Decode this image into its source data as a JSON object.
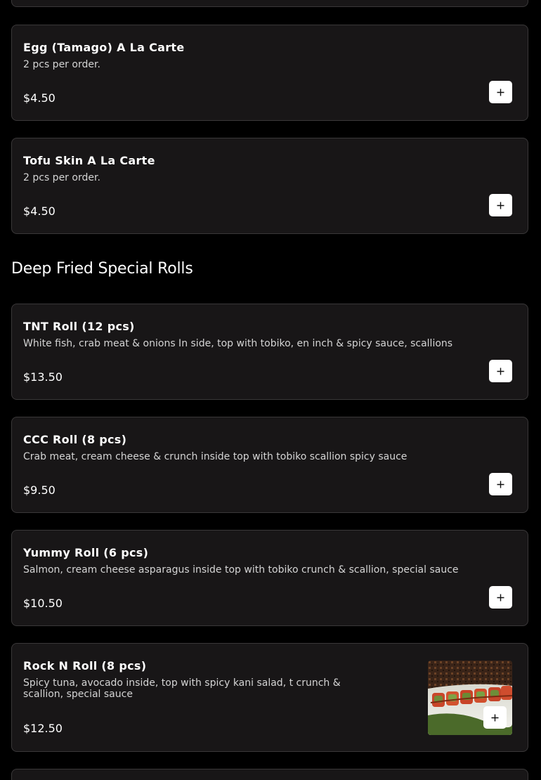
{
  "sections": [
    {
      "items": [
        {
          "name": "Egg (Tamago) A La Carte",
          "description": "2 pcs per order.",
          "price": "$4.50"
        },
        {
          "name": "Tofu Skin A La Carte",
          "description": "2 pcs per order.",
          "price": "$4.50"
        }
      ]
    },
    {
      "title": "Deep Fried Special Rolls",
      "items": [
        {
          "name": "TNT Roll (12 pcs)",
          "description": "White fish, crab meat & onions In side, top with tobiko, en inch & spicy sauce, scallions",
          "price": "$13.50"
        },
        {
          "name": "CCC Roll (8 pcs)",
          "description": "Crab meat, cream cheese & crunch inside top with tobiko scallion spicy sauce",
          "price": "$9.50"
        },
        {
          "name": "Yummy Roll (6 pcs)",
          "description": "Salmon, cream cheese asparagus inside top with tobiko crunch & scallion, special sauce",
          "price": "$10.50"
        },
        {
          "name": "Rock N Roll (8 pcs)",
          "description": "Spicy tuna, avocado inside, top with spicy kani salad, t crunch & scallion, special sauce",
          "price": "$12.50"
        }
      ]
    }
  ],
  "icons": {
    "add": "plus-icon"
  },
  "colors": {
    "background": "#000000",
    "card": "#181617",
    "card_border": "#3a3839",
    "button": "#ffffff"
  }
}
